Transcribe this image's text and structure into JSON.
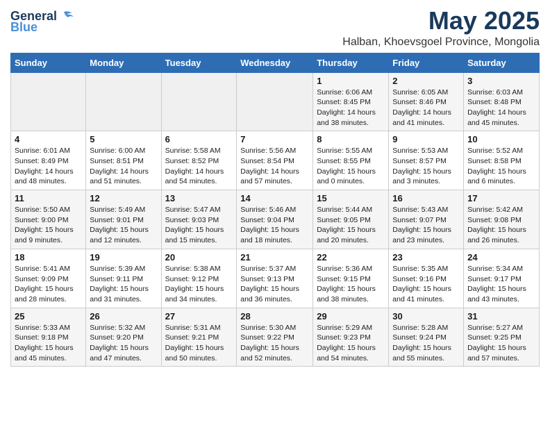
{
  "logo": {
    "line1": "General",
    "line2": "Blue"
  },
  "title": "May 2025",
  "location": "Halban, Khoevsgoel Province, Mongolia",
  "header": {
    "days": [
      "Sunday",
      "Monday",
      "Tuesday",
      "Wednesday",
      "Thursday",
      "Friday",
      "Saturday"
    ]
  },
  "weeks": [
    {
      "cells": [
        {
          "empty": true
        },
        {
          "empty": true
        },
        {
          "empty": true
        },
        {
          "empty": true
        },
        {
          "day": 1,
          "info": "Sunrise: 6:06 AM\nSunset: 8:45 PM\nDaylight: 14 hours\nand 38 minutes."
        },
        {
          "day": 2,
          "info": "Sunrise: 6:05 AM\nSunset: 8:46 PM\nDaylight: 14 hours\nand 41 minutes."
        },
        {
          "day": 3,
          "info": "Sunrise: 6:03 AM\nSunset: 8:48 PM\nDaylight: 14 hours\nand 45 minutes."
        }
      ]
    },
    {
      "cells": [
        {
          "day": 4,
          "info": "Sunrise: 6:01 AM\nSunset: 8:49 PM\nDaylight: 14 hours\nand 48 minutes."
        },
        {
          "day": 5,
          "info": "Sunrise: 6:00 AM\nSunset: 8:51 PM\nDaylight: 14 hours\nand 51 minutes."
        },
        {
          "day": 6,
          "info": "Sunrise: 5:58 AM\nSunset: 8:52 PM\nDaylight: 14 hours\nand 54 minutes."
        },
        {
          "day": 7,
          "info": "Sunrise: 5:56 AM\nSunset: 8:54 PM\nDaylight: 14 hours\nand 57 minutes."
        },
        {
          "day": 8,
          "info": "Sunrise: 5:55 AM\nSunset: 8:55 PM\nDaylight: 15 hours\nand 0 minutes."
        },
        {
          "day": 9,
          "info": "Sunrise: 5:53 AM\nSunset: 8:57 PM\nDaylight: 15 hours\nand 3 minutes."
        },
        {
          "day": 10,
          "info": "Sunrise: 5:52 AM\nSunset: 8:58 PM\nDaylight: 15 hours\nand 6 minutes."
        }
      ]
    },
    {
      "cells": [
        {
          "day": 11,
          "info": "Sunrise: 5:50 AM\nSunset: 9:00 PM\nDaylight: 15 hours\nand 9 minutes."
        },
        {
          "day": 12,
          "info": "Sunrise: 5:49 AM\nSunset: 9:01 PM\nDaylight: 15 hours\nand 12 minutes."
        },
        {
          "day": 13,
          "info": "Sunrise: 5:47 AM\nSunset: 9:03 PM\nDaylight: 15 hours\nand 15 minutes."
        },
        {
          "day": 14,
          "info": "Sunrise: 5:46 AM\nSunset: 9:04 PM\nDaylight: 15 hours\nand 18 minutes."
        },
        {
          "day": 15,
          "info": "Sunrise: 5:44 AM\nSunset: 9:05 PM\nDaylight: 15 hours\nand 20 minutes."
        },
        {
          "day": 16,
          "info": "Sunrise: 5:43 AM\nSunset: 9:07 PM\nDaylight: 15 hours\nand 23 minutes."
        },
        {
          "day": 17,
          "info": "Sunrise: 5:42 AM\nSunset: 9:08 PM\nDaylight: 15 hours\nand 26 minutes."
        }
      ]
    },
    {
      "cells": [
        {
          "day": 18,
          "info": "Sunrise: 5:41 AM\nSunset: 9:09 PM\nDaylight: 15 hours\nand 28 minutes."
        },
        {
          "day": 19,
          "info": "Sunrise: 5:39 AM\nSunset: 9:11 PM\nDaylight: 15 hours\nand 31 minutes."
        },
        {
          "day": 20,
          "info": "Sunrise: 5:38 AM\nSunset: 9:12 PM\nDaylight: 15 hours\nand 34 minutes."
        },
        {
          "day": 21,
          "info": "Sunrise: 5:37 AM\nSunset: 9:13 PM\nDaylight: 15 hours\nand 36 minutes."
        },
        {
          "day": 22,
          "info": "Sunrise: 5:36 AM\nSunset: 9:15 PM\nDaylight: 15 hours\nand 38 minutes."
        },
        {
          "day": 23,
          "info": "Sunrise: 5:35 AM\nSunset: 9:16 PM\nDaylight: 15 hours\nand 41 minutes."
        },
        {
          "day": 24,
          "info": "Sunrise: 5:34 AM\nSunset: 9:17 PM\nDaylight: 15 hours\nand 43 minutes."
        }
      ]
    },
    {
      "cells": [
        {
          "day": 25,
          "info": "Sunrise: 5:33 AM\nSunset: 9:18 PM\nDaylight: 15 hours\nand 45 minutes."
        },
        {
          "day": 26,
          "info": "Sunrise: 5:32 AM\nSunset: 9:20 PM\nDaylight: 15 hours\nand 47 minutes."
        },
        {
          "day": 27,
          "info": "Sunrise: 5:31 AM\nSunset: 9:21 PM\nDaylight: 15 hours\nand 50 minutes."
        },
        {
          "day": 28,
          "info": "Sunrise: 5:30 AM\nSunset: 9:22 PM\nDaylight: 15 hours\nand 52 minutes."
        },
        {
          "day": 29,
          "info": "Sunrise: 5:29 AM\nSunset: 9:23 PM\nDaylight: 15 hours\nand 54 minutes."
        },
        {
          "day": 30,
          "info": "Sunrise: 5:28 AM\nSunset: 9:24 PM\nDaylight: 15 hours\nand 55 minutes."
        },
        {
          "day": 31,
          "info": "Sunrise: 5:27 AM\nSunset: 9:25 PM\nDaylight: 15 hours\nand 57 minutes."
        }
      ]
    }
  ]
}
